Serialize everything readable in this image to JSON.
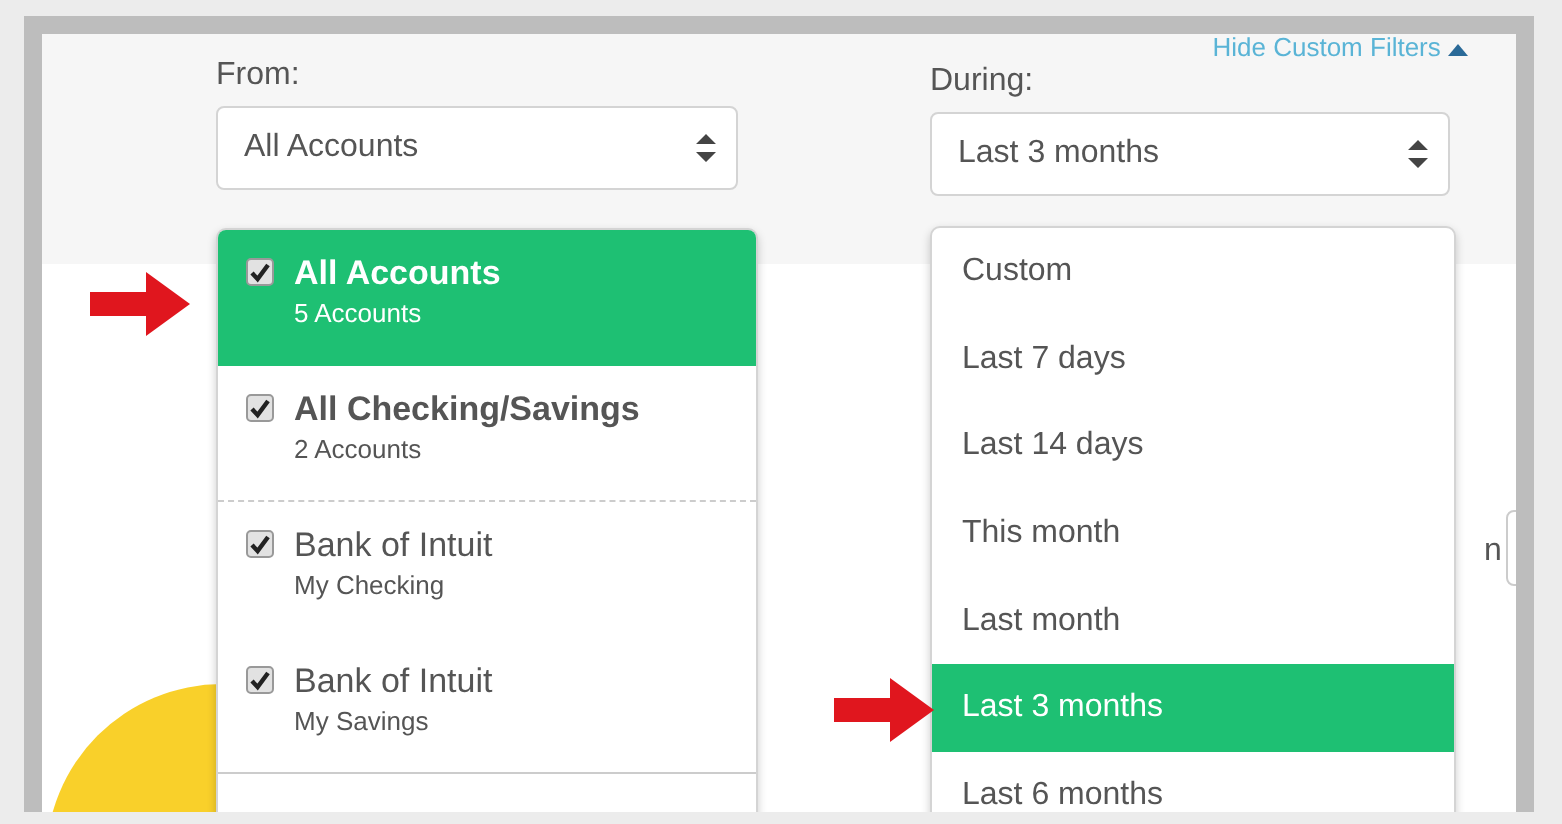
{
  "filters_link": {
    "label": "Hide Custom Filters",
    "expanded": true
  },
  "from": {
    "label": "From:",
    "value": "All Accounts",
    "options": [
      {
        "kind": "group",
        "title": "All Accounts",
        "subtitle": "5 Accounts",
        "checked": true,
        "selected": true
      },
      {
        "kind": "group",
        "title": "All Checking/Savings",
        "subtitle": "2 Accounts",
        "checked": true,
        "selected": false
      },
      {
        "kind": "account",
        "title": "Bank of Intuit",
        "subtitle": "My Checking",
        "checked": true,
        "selected": false
      },
      {
        "kind": "account",
        "title": "Bank of Intuit",
        "subtitle": "My Savings",
        "checked": true,
        "selected": false
      }
    ]
  },
  "during": {
    "label": "During:",
    "value": "Last 3 months",
    "options": [
      {
        "label": "Custom",
        "selected": false
      },
      {
        "label": "Last 7 days",
        "selected": false
      },
      {
        "label": "Last 14 days",
        "selected": false
      },
      {
        "label": "This month",
        "selected": false
      },
      {
        "label": "Last month",
        "selected": false
      },
      {
        "label": "Last 3 months",
        "selected": true
      },
      {
        "label": "Last 6 months",
        "selected": false
      }
    ]
  },
  "partial_label": "n"
}
